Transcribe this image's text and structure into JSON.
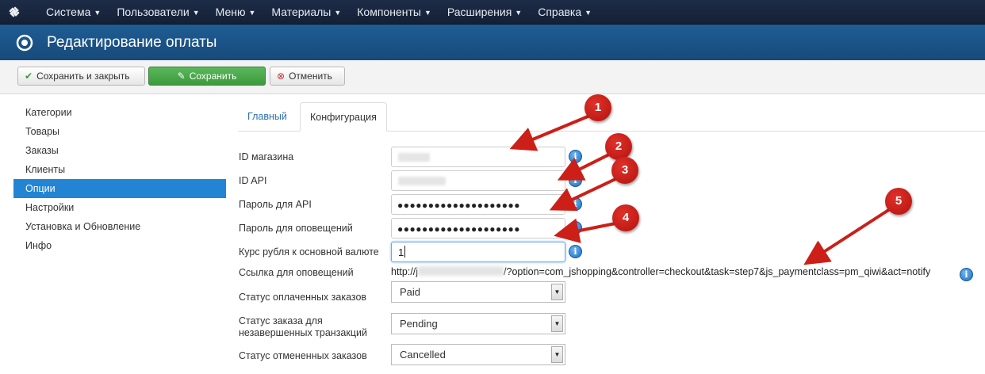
{
  "nav": {
    "items": [
      {
        "label": "Система"
      },
      {
        "label": "Пользователи"
      },
      {
        "label": "Меню"
      },
      {
        "label": "Материалы"
      },
      {
        "label": "Компоненты"
      },
      {
        "label": "Расширения"
      },
      {
        "label": "Справка"
      }
    ],
    "caret": "▼"
  },
  "title": "Редактирование оплаты",
  "toolbar": {
    "save_close_label": "Сохранить и закрыть",
    "save_label": "Сохранить",
    "cancel_label": "Отменить"
  },
  "sidebar": {
    "items": [
      {
        "label": "Категории"
      },
      {
        "label": "Товары"
      },
      {
        "label": "Заказы"
      },
      {
        "label": "Клиенты"
      },
      {
        "label": "Опции"
      },
      {
        "label": "Настройки"
      },
      {
        "label": "Установка и Обновление"
      },
      {
        "label": "Инфо"
      }
    ],
    "active_index": 4
  },
  "tabs": [
    {
      "label": "Главный"
    },
    {
      "label": "Конфигурация"
    }
  ],
  "form": {
    "shop_id_label": "ID магазина",
    "api_id_label": "ID API",
    "api_password_label": "Пароль для API",
    "api_password_value": "●●●●●●●●●●●●●●●●●●●●",
    "notify_password_label": "Пароль для оповещений",
    "notify_password_value": "●●●●●●●●●●●●●●●●●●●●",
    "rate_label": "Курс рубля к основной валюте",
    "rate_value": "1",
    "notify_url_label": "Ссылка для оповещений",
    "notify_url_prefix": "http://j",
    "notify_url_suffix": "/?option=com_jshopping&controller=checkout&task=step7&js_paymentclass=pm_qiwi&act=notify",
    "paid_status_label": "Статус оплаченных заказов",
    "paid_status_value": "Paid",
    "pending_status_label_1": "Статус заказа для",
    "pending_status_label_2": "незавершенных транзакций",
    "pending_status_value": "Pending",
    "cancelled_status_label": "Статус отмененных заказов",
    "cancelled_status_value": "Cancelled"
  },
  "annotations": [
    "1",
    "2",
    "3",
    "4",
    "5"
  ],
  "colors": {
    "nav_bg": "#1d2c47",
    "title_bg": "#1f5d94",
    "active_sidebar": "#2384d3",
    "save_green": "#4cae4c",
    "annotation_red": "#cc1f18"
  }
}
